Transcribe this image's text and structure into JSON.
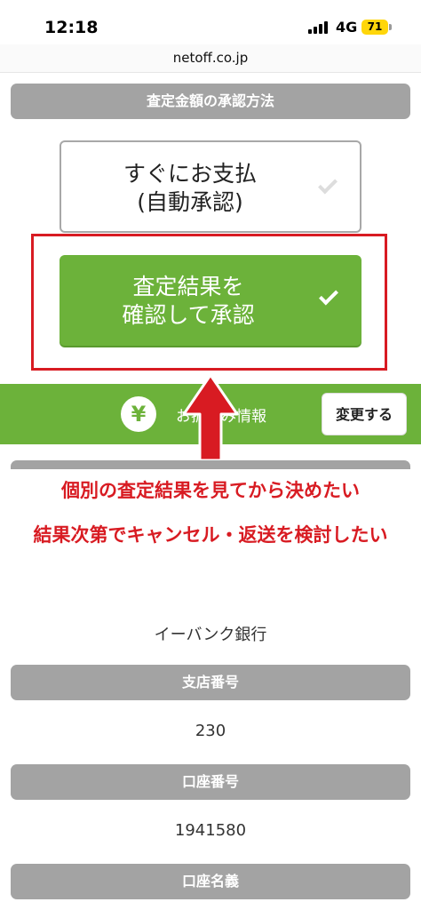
{
  "status": {
    "time": "12:18",
    "network": "4G",
    "battery": "71",
    "battery_color": "#ffd60a"
  },
  "browser": {
    "url": "netoff.co.jp"
  },
  "approval": {
    "section_title": "査定金額の承認方法",
    "option_auto_line1": "すぐにお支払",
    "option_auto_line2": "(自動承認)",
    "option_confirm_line1": "査定結果を",
    "option_confirm_line2": "確認して承認",
    "check_icon": "check-icon"
  },
  "transfer": {
    "yen_icon": "¥",
    "label": "お振込み情報",
    "change_button": "変更する"
  },
  "annotation": {
    "line1": "個別の査定結果を見てから決めたい",
    "line2": "結果次第でキャンセル・返送を検討したい",
    "color": "#d81b22"
  },
  "bank": {
    "bank_name": "イーバンク銀行",
    "branch_label": "支店番号",
    "branch_value": "230",
    "account_label": "口座番号",
    "account_value": "1941580",
    "holder_label": "口座名義"
  },
  "colors": {
    "green": "#6cb23a",
    "gray": "#a3a3a3",
    "red": "#d81b22"
  }
}
